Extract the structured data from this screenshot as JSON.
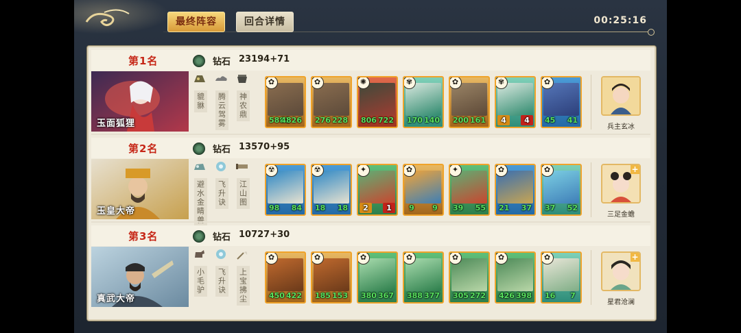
{
  "header": {
    "tabs": [
      {
        "label": "最终阵容",
        "active": true
      },
      {
        "label": "回合详情",
        "active": false
      }
    ],
    "timer": "00:25:16"
  },
  "rows": [
    {
      "rank": "第1名",
      "tier": "钻石",
      "score": "23194+71",
      "hero": "玉面狐狸",
      "treasures": [
        "貔貅",
        "腾云驾雾",
        "神农鼎"
      ],
      "cards": [
        {
          "s1": "5881",
          "s2": "4826"
        },
        {
          "s1": "276",
          "s2": "228"
        },
        {
          "s1": "806",
          "s2": "722"
        },
        {
          "s1": "170",
          "s2": "140"
        },
        {
          "s1": "200",
          "s2": "161"
        },
        {
          "s1": "4",
          "s2": "4"
        },
        {
          "s1": "45",
          "s2": "41"
        }
      ],
      "pet": "兵主玄冰"
    },
    {
      "rank": "第2名",
      "tier": "钻石",
      "score": "13570+95",
      "hero": "玉皇大帝",
      "treasures": [
        "避水金睛兽",
        "飞升诀",
        "江山图"
      ],
      "cards": [
        {
          "s1": "98",
          "s2": "84"
        },
        {
          "s1": "18",
          "s2": "18"
        },
        {
          "s1": "2",
          "s2": "1"
        },
        {
          "s1": "9",
          "s2": "9"
        },
        {
          "s1": "39",
          "s2": "55"
        },
        {
          "s1": "21",
          "s2": "37"
        },
        {
          "s1": "37",
          "s2": "52"
        }
      ],
      "pet": "三足金蟾"
    },
    {
      "rank": "第3名",
      "tier": "钻石",
      "score": "10727+30",
      "hero": "真武大帝",
      "treasures": [
        "小毛驴",
        "飞升诀",
        "上宝拂尘"
      ],
      "cards": [
        {
          "s1": "450",
          "s2": "422"
        },
        {
          "s1": "185",
          "s2": "153"
        },
        {
          "s1": "380",
          "s2": "367"
        },
        {
          "s1": "388",
          "s2": "377"
        },
        {
          "s1": "305",
          "s2": "272"
        },
        {
          "s1": "426",
          "s2": "398"
        },
        {
          "s1": "16",
          "s2": "7"
        }
      ],
      "pet": "星君沧澜"
    }
  ],
  "colors": {
    "rank_red": "#c62717",
    "stat_green": "#56e05d",
    "panel_bg": "#efeadc",
    "screen_bg": "#222b37"
  }
}
